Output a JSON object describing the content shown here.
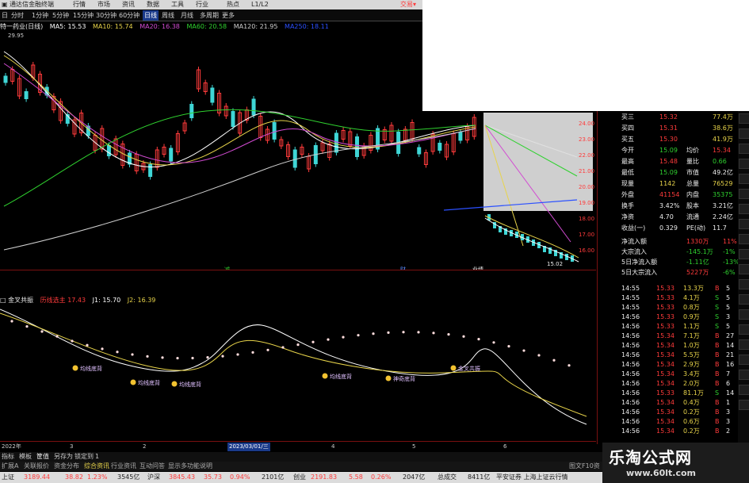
{
  "titlebar": {
    "app_title": "通达信金融终端",
    "menus": [
      "行情",
      "市场",
      "资讯",
      "数据",
      "工具",
      "行业",
      "热点",
      "L1/L2"
    ],
    "trade_label": "交易▾"
  },
  "toolbar": {
    "tabs": [
      "分时",
      "1分钟",
      "5分钟",
      "15分钟",
      "30分钟",
      "60分钟",
      "日线",
      "周线",
      "月线",
      "多周期",
      "更多"
    ],
    "active": "日线",
    "prefix": "日"
  },
  "ma_legend": {
    "stock": "特一药业(日线)",
    "items": [
      {
        "label": "MA5: 15.53",
        "color": "#ffffff"
      },
      {
        "label": "MA10: 15.74",
        "color": "#e8d44a"
      },
      {
        "label": "MA20: 16.38",
        "color": "#d24bd2"
      },
      {
        "label": "MA60: 20.58",
        "color": "#2fd12f"
      },
      {
        "label": "MA120: 21.95",
        "color": "#cfcfcf"
      },
      {
        "label": "MA250: 18.11",
        "color": "#2b50ff"
      }
    ]
  },
  "main_chart": {
    "high_label": "29.95",
    "last_label": "15.02",
    "price_ticks": [
      "24.00",
      "23.00",
      "22.00",
      "21.00",
      "20.00",
      "19.00",
      "18.00",
      "17.00",
      "16.00"
    ],
    "markers": [
      {
        "label": "减",
        "color": "#2fd12f"
      },
      {
        "label": "财",
        "color": "#5a8cff"
      },
      {
        "label": "业绩",
        "color": "#ffffff"
      }
    ]
  },
  "sub_legend": {
    "name": "金叉共振",
    "items": [
      {
        "label": "历线选主 17.43",
        "color": "#ff3b3b"
      },
      {
        "label": "J1: 15.70",
        "color": "#ffffff"
      },
      {
        "label": "J2: 16.39",
        "color": "#e8d44a"
      }
    ]
  },
  "sub_chart": {
    "ticks": [
      "30.00",
      "28.00",
      "26.00",
      "24.00",
      "22.00",
      "20.00",
      "18.00",
      "16.00"
    ],
    "labels": [
      "均线底背",
      "均线底背",
      "均线底背",
      "均线底背",
      "神奇底背",
      "金叉共振"
    ]
  },
  "datebar": {
    "year": "2022年",
    "m3": "3",
    "m2": "2",
    "date_highlight": "2023/03/01/三",
    "m4": "4",
    "m5": "5",
    "m6": "6"
  },
  "tabbar": {
    "tabs": [
      "指标",
      "模板",
      "筐值",
      "另存为",
      "锁定到",
      "1"
    ]
  },
  "funcbar": {
    "items": [
      "扩展A",
      "关联报价",
      "资金分布",
      "综合资讯",
      "行业资讯",
      "互动问答",
      "显示多功能说明"
    ],
    "right": "图文F10资"
  },
  "statusbar": {
    "sh_label": "上证",
    "sh_val": "3189.44",
    "sh_chg": "38.82",
    "sh_pct": "1.23%",
    "sh_amt": "3545亿",
    "sz_label": "沪深",
    "sz_val": "3845.43",
    "sz_chg": "35.73",
    "sz_pct": "0.94%",
    "sz_amt": "2101亿",
    "cy_label": "创业",
    "cy_val": "2191.83",
    "cy_chg": "5.58",
    "cy_pct": "0.26%",
    "cy_amt": "2047亿",
    "total_label": "总成交",
    "total_amt": "8411亿",
    "broker": "平安证券 上海上证云行情"
  },
  "quote_panel": {
    "rows": [
      {
        "l1": "买三",
        "v1": "15.32",
        "v1c": "red",
        "l2": "",
        "v2": "77.4万",
        "v2c": "yellow"
      },
      {
        "l1": "买四",
        "v1": "15.31",
        "v1c": "red",
        "l2": "",
        "v2": "38.6万",
        "v2c": "yellow"
      },
      {
        "l1": "买五",
        "v1": "15.30",
        "v1c": "red",
        "l2": "",
        "v2": "41.9万",
        "v2c": "yellow"
      },
      {
        "l1": "今开",
        "v1": "15.09",
        "v1c": "green",
        "l2": "均价",
        "v2": "15.34",
        "v2c": "red"
      },
      {
        "l1": "最高",
        "v1": "15.48",
        "v1c": "red",
        "l2": "量比",
        "v2": "0.66",
        "v2c": "green"
      },
      {
        "l1": "最低",
        "v1": "15.09",
        "v1c": "green",
        "l2": "市值",
        "v2": "49.2亿",
        "v2c": "white"
      },
      {
        "l1": "现量",
        "v1": "1142",
        "v1c": "yellow",
        "l2": "总量",
        "v2": "76529",
        "v2c": "yellow"
      },
      {
        "l1": "外盘",
        "v1": "41154",
        "v1c": "red",
        "l2": "内盘",
        "v2": "35375",
        "v2c": "green"
      },
      {
        "l1": "换手",
        "v1": "3.42%",
        "v1c": "white",
        "l2": "股本",
        "v2": "3.21亿",
        "v2c": "white"
      },
      {
        "l1": "净资",
        "v1": "4.70",
        "v1c": "white",
        "l2": "流通",
        "v2": "2.24亿",
        "v2c": "white"
      },
      {
        "l1": "收益(一)",
        "v1": "0.329",
        "v1c": "white",
        "l2": "PE(动)",
        "v2": "11.7",
        "v2c": "white"
      }
    ],
    "flows": [
      {
        "label": "净流入额",
        "val": "1330万",
        "valc": "red",
        "pct": "11%",
        "pctc": "red"
      },
      {
        "label": "大宗流入",
        "val": "-145.1万",
        "valc": "green",
        "pct": "-1%",
        "pctc": "green"
      },
      {
        "label": "5日净流入额",
        "val": "-1.11亿",
        "valc": "green",
        "pct": "-13%",
        "pctc": "green"
      },
      {
        "label": "5日大宗流入",
        "val": "5227万",
        "valc": "red",
        "pct": "-6%",
        "pctc": "green"
      }
    ]
  },
  "trades": [
    {
      "t": "14:55",
      "p": "15.33",
      "v": "13.3万",
      "s": "B",
      "n": "5"
    },
    {
      "t": "14:55",
      "p": "15.33",
      "v": "4.1万",
      "s": "S",
      "n": "5"
    },
    {
      "t": "14:55",
      "p": "15.33",
      "v": "0.8万",
      "s": "S",
      "n": "5"
    },
    {
      "t": "14:56",
      "p": "15.33",
      "v": "0.9万",
      "s": "S",
      "n": "3"
    },
    {
      "t": "14:56",
      "p": "15.33",
      "v": "1.1万",
      "s": "S",
      "n": "5"
    },
    {
      "t": "14:56",
      "p": "15.34",
      "v": "7.1万",
      "s": "B",
      "n": "27"
    },
    {
      "t": "14:56",
      "p": "15.34",
      "v": "1.0万",
      "s": "B",
      "n": "14"
    },
    {
      "t": "14:56",
      "p": "15.34",
      "v": "5.5万",
      "s": "B",
      "n": "21"
    },
    {
      "t": "14:56",
      "p": "15.34",
      "v": "2.9万",
      "s": "B",
      "n": "16"
    },
    {
      "t": "14:56",
      "p": "15.34",
      "v": "3.4万",
      "s": "B",
      "n": "7"
    },
    {
      "t": "14:56",
      "p": "15.34",
      "v": "2.0万",
      "s": "B",
      "n": "6"
    },
    {
      "t": "14:56",
      "p": "15.33",
      "v": "81.1万",
      "s": "S",
      "n": "14"
    },
    {
      "t": "14:56",
      "p": "15.34",
      "v": "0.4万",
      "s": "B",
      "n": "1"
    },
    {
      "t": "14:56",
      "p": "15.34",
      "v": "0.2万",
      "s": "B",
      "n": "3"
    },
    {
      "t": "14:56",
      "p": "15.34",
      "v": "0.6万",
      "s": "B",
      "n": "3"
    },
    {
      "t": "14:56",
      "p": "15.34",
      "v": "0.2万",
      "s": "B",
      "n": "2"
    }
  ],
  "sidebar": {
    "buttons": [
      "",
      "",
      "",
      "",
      "",
      "",
      "",
      "",
      "",
      "",
      "",
      "",
      "",
      "",
      "",
      "",
      "",
      "",
      "",
      ""
    ]
  },
  "watermark": {
    "title": "乐淘公式网",
    "url": "www.60lt.com"
  }
}
